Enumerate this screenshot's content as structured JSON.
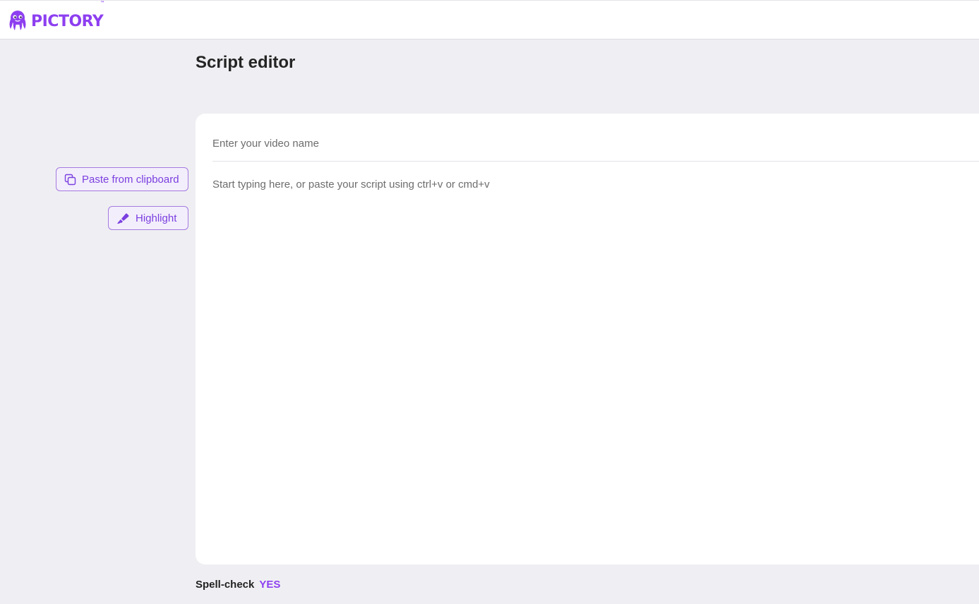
{
  "brand": {
    "name": "PICTORY",
    "trademark": "™",
    "logo_icon": "octopus-logo-icon",
    "color": "#8d3ff0"
  },
  "page": {
    "title": "Script editor"
  },
  "tools": {
    "paste_label": "Paste from clipboard",
    "paste_icon": "copy-icon",
    "highlight_label": "Highlight",
    "highlight_icon": "highlighter-icon"
  },
  "editor": {
    "video_name_placeholder": "Enter your video name",
    "video_name_value": "",
    "script_placeholder": "Start typing here, or paste your script using ctrl+v or cmd+v",
    "script_value": ""
  },
  "spellcheck": {
    "label": "Spell-check",
    "value": "YES"
  },
  "colors": {
    "accent": "#8d3ff0",
    "background": "#efeff3",
    "card": "#ffffff"
  }
}
